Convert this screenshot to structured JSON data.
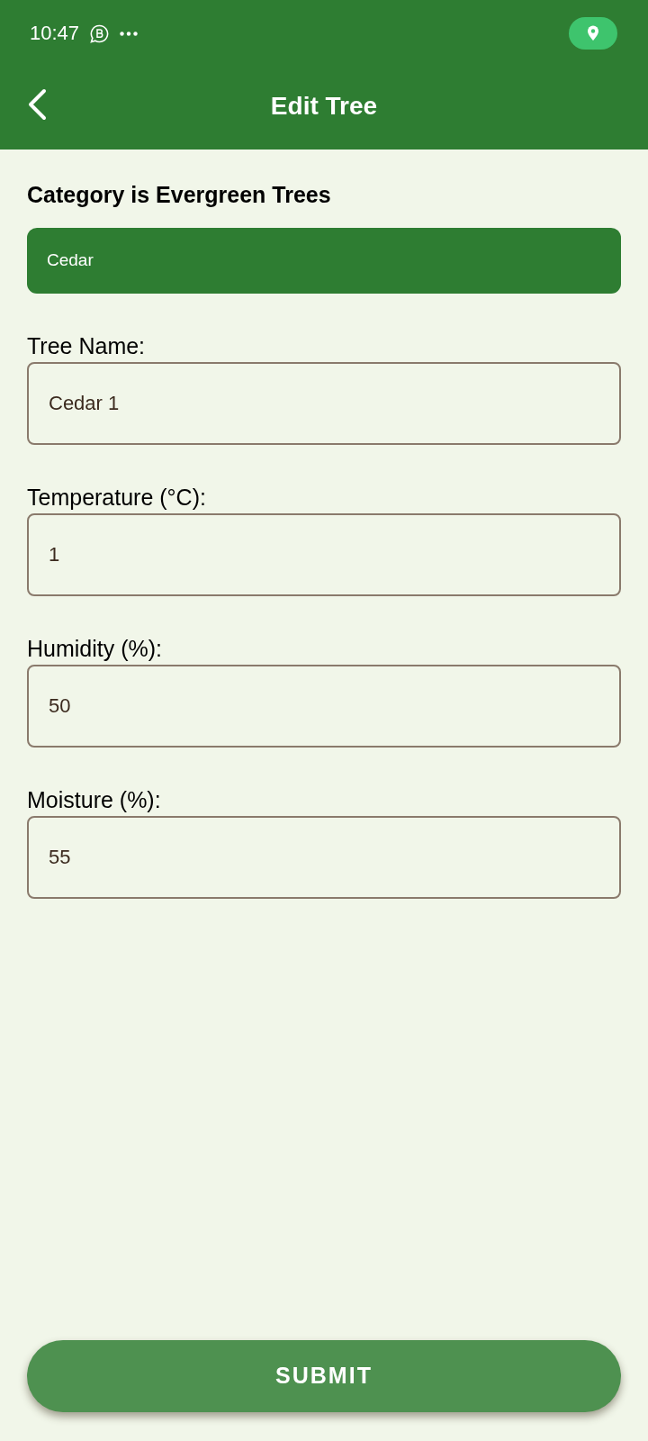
{
  "status_bar": {
    "time": "10:47"
  },
  "app_bar": {
    "title": "Edit Tree"
  },
  "category": {
    "heading": "Category is Evergreen Trees",
    "tree_type": "Cedar"
  },
  "fields": [
    {
      "label": "Tree Name:",
      "value": "Cedar 1"
    },
    {
      "label": "Temperature (°C):",
      "value": "1"
    },
    {
      "label": "Humidity (%):",
      "value": "50"
    },
    {
      "label": "Moisture (%):",
      "value": "55"
    }
  ],
  "submit_button": {
    "label": "SUBMIT"
  }
}
